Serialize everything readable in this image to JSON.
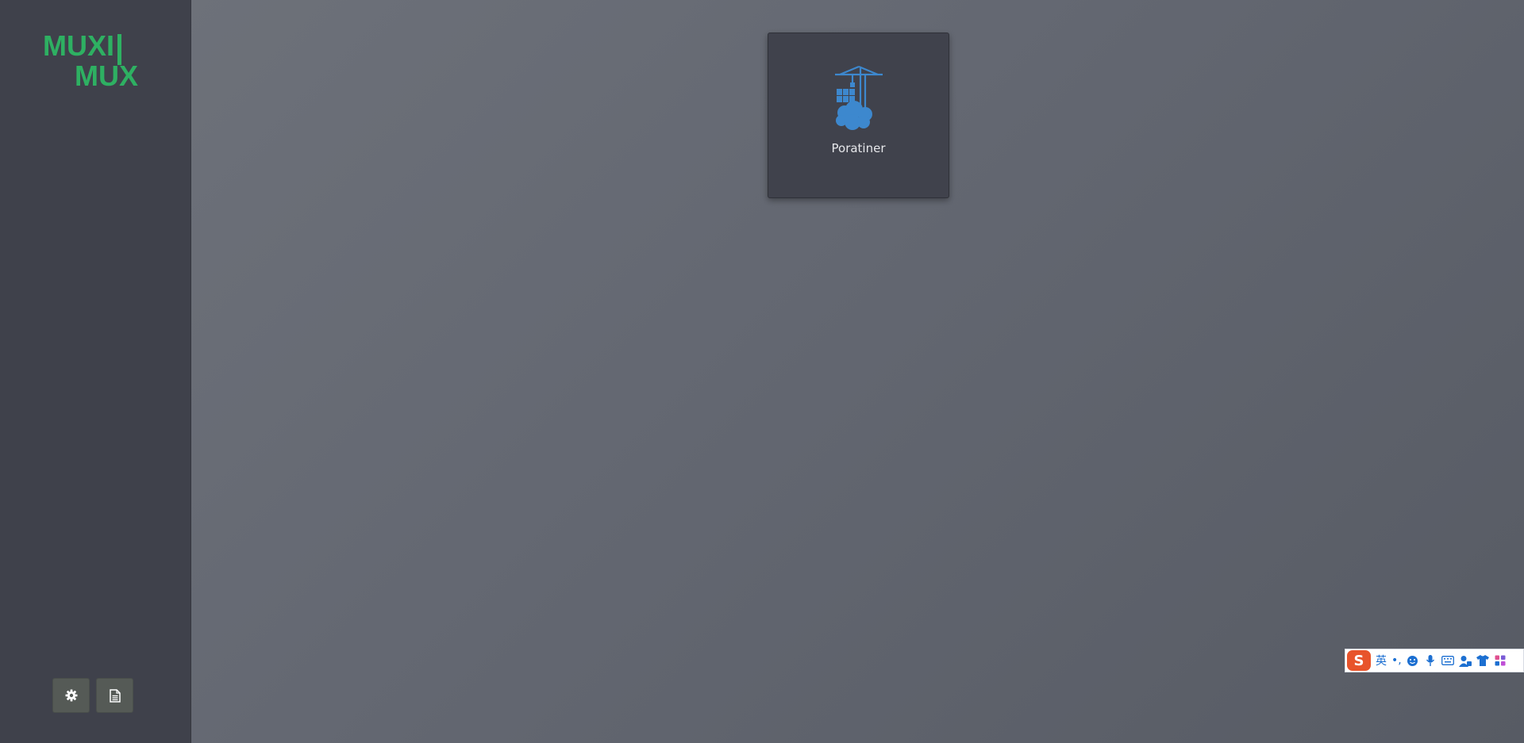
{
  "sidebar": {
    "logo": {
      "line1": "MUXI",
      "line2": "MUX",
      "color": "#2eb062"
    },
    "buttons": [
      {
        "icon": "gear-icon"
      },
      {
        "icon": "file-icon"
      }
    ]
  },
  "main": {
    "apps": [
      {
        "label": "Poratiner",
        "icon": "portainer-crane-icon",
        "icon_color": "#3d88ce"
      }
    ]
  },
  "ime_toolbar": {
    "mode_label": "英",
    "punct_label": "•,",
    "brand_color": "#e8542b",
    "accent_color": "#1c6fd1",
    "icons": [
      "sogou-logo-icon",
      "emoji-icon",
      "microphone-icon",
      "keyboard-icon",
      "user-icon",
      "shirt-icon",
      "grid-icon"
    ]
  }
}
